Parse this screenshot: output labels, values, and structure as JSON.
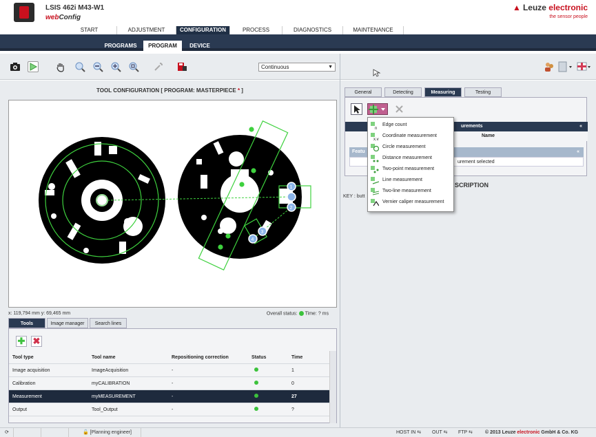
{
  "header": {
    "device_name": "LSIS 462i M43-W1",
    "app_name_web": "web",
    "app_name_config": "Config",
    "brand_leuze": "Leuze",
    "brand_electronic": "electronic",
    "tagline": "the sensor people"
  },
  "main_nav": [
    "START",
    "ADJUSTMENT",
    "CONFIGURATION",
    "PROCESS",
    "DIAGNOSTICS",
    "MAINTENANCE"
  ],
  "sub_nav": [
    "PROGRAMS",
    "PROGRAM",
    "DEVICE"
  ],
  "toolbar": {
    "mode_value": "Continuous",
    "icons": [
      "camera-icon",
      "play-icon",
      "hand-icon",
      "zoom-in-icon",
      "zoom-out-icon",
      "zoom-fit-icon",
      "zoom-reset-icon",
      "wrench-icon",
      "save-to-device-icon"
    ],
    "right_icons": [
      "user-icon",
      "document-icon",
      "flag-icon"
    ]
  },
  "tool_config": {
    "title_prefix": "TOOL CONFIGURATION   [ PROGRAM: MASTERPIECE",
    "title_star": " *",
    "title_suffix": " ]"
  },
  "status": {
    "coords": "x: 119,794 mm y: 69,465 mm",
    "overall": "Overall status:",
    "time": "Time: ? ms"
  },
  "left_tabs": [
    "Tools",
    "Image manager",
    "Search lines"
  ],
  "tool_table": {
    "headers": [
      "Tool type",
      "Tool name",
      "Repositioning correction",
      "Status",
      "Time"
    ],
    "rows": [
      {
        "type": "Image acquisition",
        "name": "ImageAcquisition",
        "repos": "-",
        "time": "1"
      },
      {
        "type": "Calibration",
        "name": "myCALIBRATION",
        "repos": "-",
        "time": "0"
      },
      {
        "type": "Measurement",
        "name": "myMEASUREMENT",
        "repos": "-",
        "time": "27"
      },
      {
        "type": "Output",
        "name": "Tool_Output",
        "repos": "-",
        "time": "?"
      }
    ]
  },
  "right_tabs": [
    "General",
    "Detecting",
    "Measuring",
    "Testing"
  ],
  "measuring": {
    "head": "urements",
    "sub": "Name",
    "feat_head": "Featu",
    "feat_sub": "urement selected"
  },
  "description": {
    "title": "SCRIPTION",
    "key": "KEY : butt"
  },
  "add_menu": [
    "Edge count",
    "Coordinate measurement",
    "Circle measurement",
    "Distance measurement",
    "Two-point measurement",
    "Line measurement",
    "Two-line measurement",
    "Vernier caliper measurement"
  ],
  "statusbar": {
    "role": "[Planning engineer]",
    "host_in": "HOST IN",
    "out": "OUT",
    "ftp": "FTP",
    "copyright_pre": "© 2013 Leuze ",
    "copyright_ele": "electronic",
    "copyright_post": " GmbH & Co. KG"
  },
  "colors": {
    "accent_red": "#c8101e",
    "nav_dark": "#2a3a52",
    "status_green": "#3cc23c",
    "overlay_green": "#3ed13e"
  }
}
